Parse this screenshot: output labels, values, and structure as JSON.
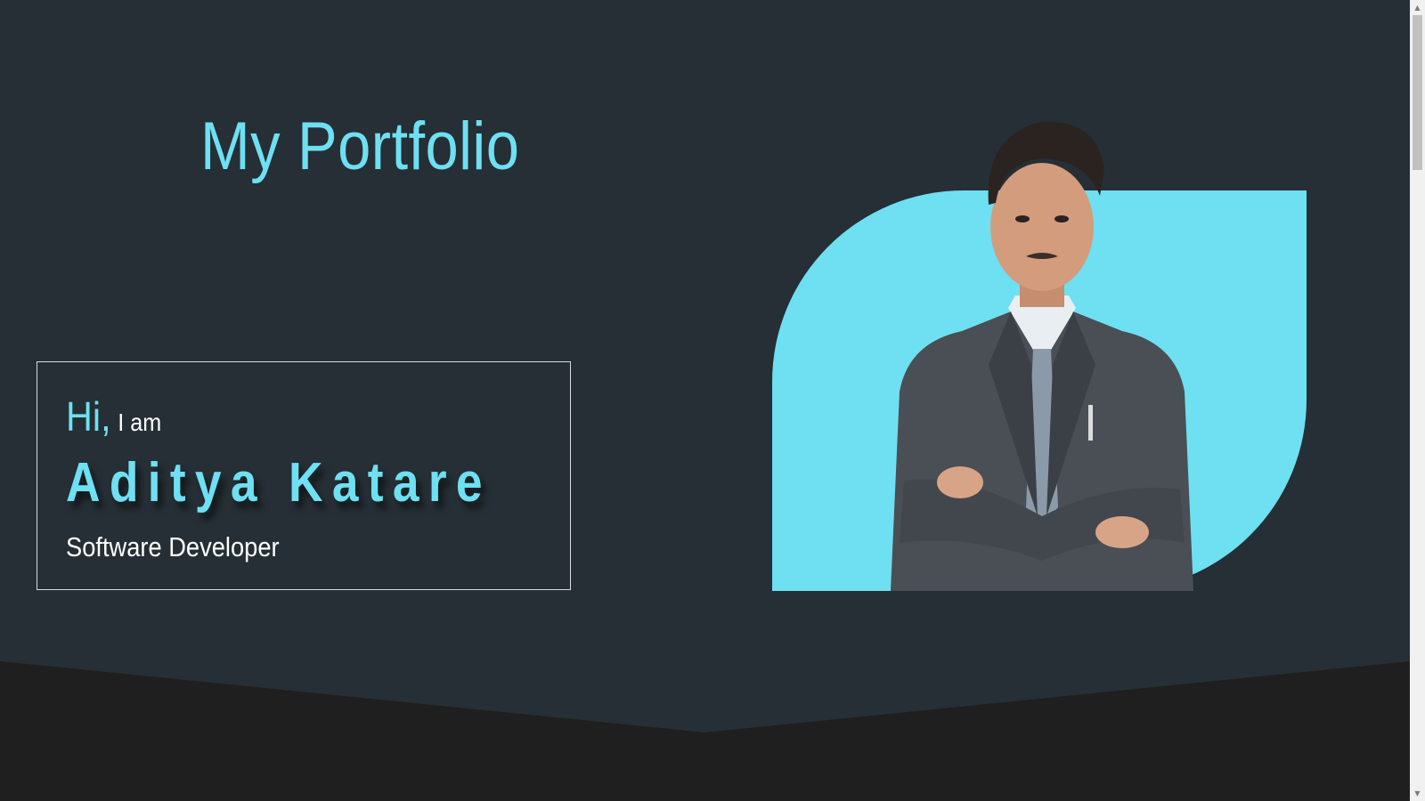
{
  "hero": {
    "title": "My Portfolio",
    "greeting_hi": "Hi,",
    "greeting_rest": "I am",
    "name": "Aditya Katare",
    "role": "Software Developer"
  },
  "colors": {
    "accent": "#6ee0f2",
    "hero_bg": "#252f35",
    "lower_bg": "#1f1f1f",
    "text": "#ffffff"
  },
  "icons": {
    "scroll_up": "triangle-up-icon",
    "scroll_down": "triangle-down-icon"
  },
  "scrollbar": {
    "up_glyph": "▲",
    "down_glyph": "▼"
  }
}
